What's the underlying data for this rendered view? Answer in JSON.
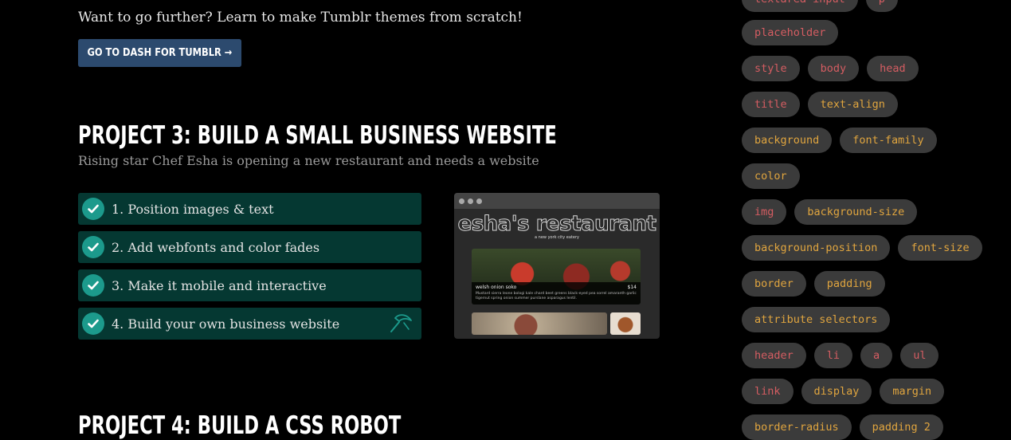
{
  "promo": {
    "text": "Want to go further? Learn to make Tumblr themes from scratch!",
    "button_label": "GO TO DASH FOR TUMBLR →"
  },
  "project3": {
    "title": "PROJECT 3: BUILD A SMALL BUSINESS WEBSITE",
    "subtitle": "Rising star Chef Esha is opening a new restaurant and needs a website",
    "lessons": [
      {
        "label": "1. Position images & text",
        "completed": true
      },
      {
        "label": "2. Add webfonts and color fades",
        "completed": true
      },
      {
        "label": "3. Make it mobile and interactive",
        "completed": true
      },
      {
        "label": "4. Build your own business website",
        "completed": true
      }
    ],
    "preview": {
      "site_title": "esha's restaurant",
      "tagline": "a new york city eatery",
      "dish_name": "welsh onion soko",
      "dish_price": "$14",
      "dish_description": "Mustard sierra leone bologi kale chard beet greens black-eyed pea sorrel amaranth garlic tigernut spring onion summer purslane asparagus lentil."
    }
  },
  "project4": {
    "title": "PROJECT 4: BUILD A CSS ROBOT"
  },
  "colors": {
    "html_tag": "#d55d62",
    "css_tag": "#e0a53f",
    "lesson_bg": "#053832",
    "check": "#1c9a8c",
    "button_bg": "#2c4a6e"
  },
  "tags": {
    "row0": [
      {
        "label": "textarea input",
        "kind": "html"
      },
      {
        "label": "p",
        "kind": "html"
      }
    ],
    "row1": [
      {
        "label": "placeholder",
        "kind": "html"
      }
    ],
    "row2": [
      {
        "label": "style",
        "kind": "html"
      },
      {
        "label": "body",
        "kind": "html"
      },
      {
        "label": "head",
        "kind": "html"
      }
    ],
    "row3": [
      {
        "label": "title",
        "kind": "html"
      },
      {
        "label": "text-align",
        "kind": "css"
      }
    ],
    "row4": [
      {
        "label": "background",
        "kind": "css"
      },
      {
        "label": "font-family",
        "kind": "css"
      }
    ],
    "row5": [
      {
        "label": "color",
        "kind": "css"
      }
    ],
    "row6": [
      {
        "label": "img",
        "kind": "html"
      },
      {
        "label": "background-size",
        "kind": "css"
      }
    ],
    "row7": [
      {
        "label": "background-position",
        "kind": "css"
      },
      {
        "label": "font-size",
        "kind": "css"
      }
    ],
    "row8": [
      {
        "label": "border",
        "kind": "css"
      },
      {
        "label": "padding",
        "kind": "css"
      }
    ],
    "row9": [
      {
        "label": "attribute selectors",
        "kind": "css"
      }
    ],
    "row10": [
      {
        "label": "header",
        "kind": "html"
      },
      {
        "label": "li",
        "kind": "html"
      },
      {
        "label": "a",
        "kind": "html"
      },
      {
        "label": "ul",
        "kind": "html"
      }
    ],
    "row11": [
      {
        "label": "link",
        "kind": "html"
      },
      {
        "label": "display",
        "kind": "css"
      },
      {
        "label": "margin",
        "kind": "css"
      }
    ],
    "row12": [
      {
        "label": "border-radius",
        "kind": "css"
      },
      {
        "label": "padding 2",
        "kind": "css"
      }
    ]
  }
}
